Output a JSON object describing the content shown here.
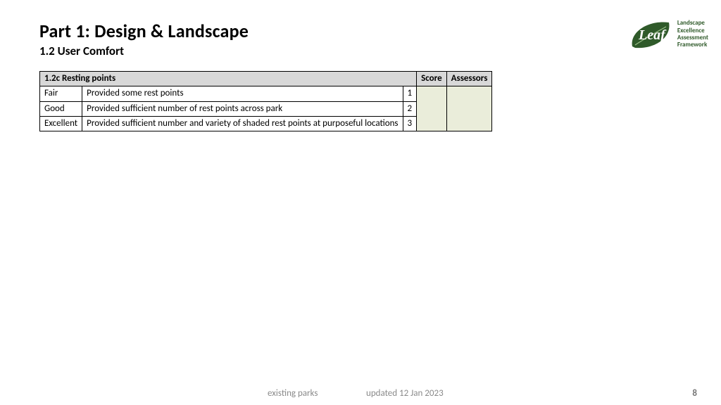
{
  "header": {
    "title": "Part 1: Design & Landscape",
    "subtitle": "1.2 User Comfort"
  },
  "logo": {
    "brand": "Leaf",
    "lines": [
      "Landscape",
      "Excellence",
      "Assessment",
      "Framework"
    ]
  },
  "table": {
    "caption": "1.2c Resting points",
    "score_header": "Score",
    "assessors_header": "Assessors",
    "rows": [
      {
        "level": "Fair",
        "desc": "Provided some rest points",
        "num": "1"
      },
      {
        "level": "Good",
        "desc": "Provided sufficient number of rest points across park",
        "num": "2"
      },
      {
        "level": "Excellent",
        "desc": "Provided sufficient number and variety of shaded rest points at purposeful locations",
        "num": "3"
      }
    ]
  },
  "footer": {
    "left": "existing parks",
    "updated": "updated 12 Jan 2023",
    "page": "8"
  }
}
